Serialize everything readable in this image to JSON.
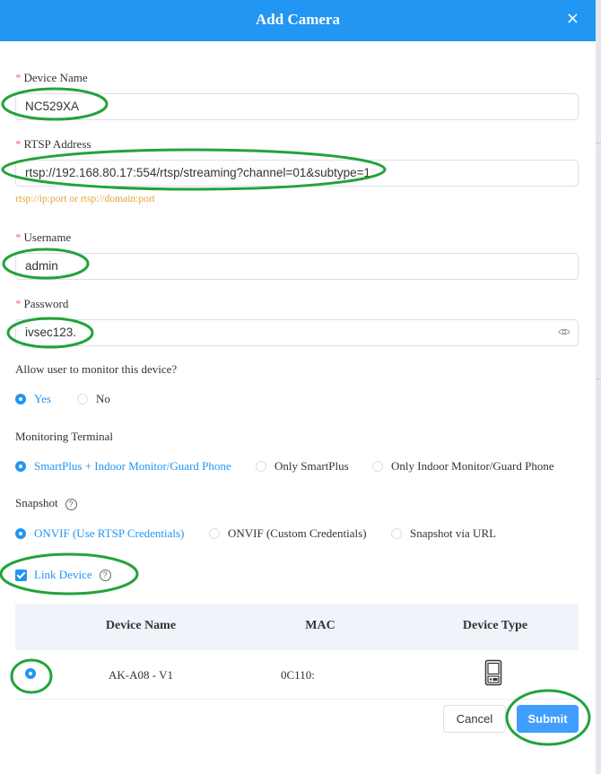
{
  "dialog": {
    "title": "Add Camera",
    "close_icon": "×"
  },
  "form": {
    "device_name": {
      "label": "Device Name",
      "value": "NC529XA"
    },
    "rtsp_address": {
      "label": "RTSP Address",
      "value": "rtsp://192.168.80.17:554/rtsp/streaming?channel=01&subtype=1",
      "hint": "rtsp://ip:port or rtsp://domain:port"
    },
    "username": {
      "label": "Username",
      "value": "admin"
    },
    "password": {
      "label": "Password",
      "value": "ivsec123."
    },
    "allow_monitor": {
      "label": "Allow user to monitor this device?",
      "options": [
        "Yes",
        "No"
      ],
      "selected": "Yes"
    },
    "monitoring_terminal": {
      "label": "Monitoring Terminal",
      "options": [
        "SmartPlus + Indoor Monitor/Guard Phone",
        "Only SmartPlus",
        "Only Indoor Monitor/Guard Phone"
      ],
      "selected": "SmartPlus + Indoor Monitor/Guard Phone"
    },
    "snapshot": {
      "label": "Snapshot",
      "options": [
        "ONVIF (Use RTSP Credentials)",
        "ONVIF (Custom Credentials)",
        "Snapshot via URL"
      ],
      "selected": "ONVIF (Use RTSP Credentials)"
    },
    "link_device": {
      "label": "Link Device",
      "checked": true
    }
  },
  "table": {
    "headers": [
      "Device Name",
      "MAC",
      "Device Type"
    ],
    "rows": [
      {
        "device_name": "AK-A08 - V1",
        "mac": "0C110:",
        "device_type_icon": "door-phone-icon",
        "selected": true
      }
    ]
  },
  "buttons": {
    "cancel": "Cancel",
    "submit": "Submit"
  },
  "colors": {
    "primary": "#2196f3",
    "required": "#f56c6c",
    "hint": "#e6a23c",
    "annotation": "#22a33a"
  }
}
